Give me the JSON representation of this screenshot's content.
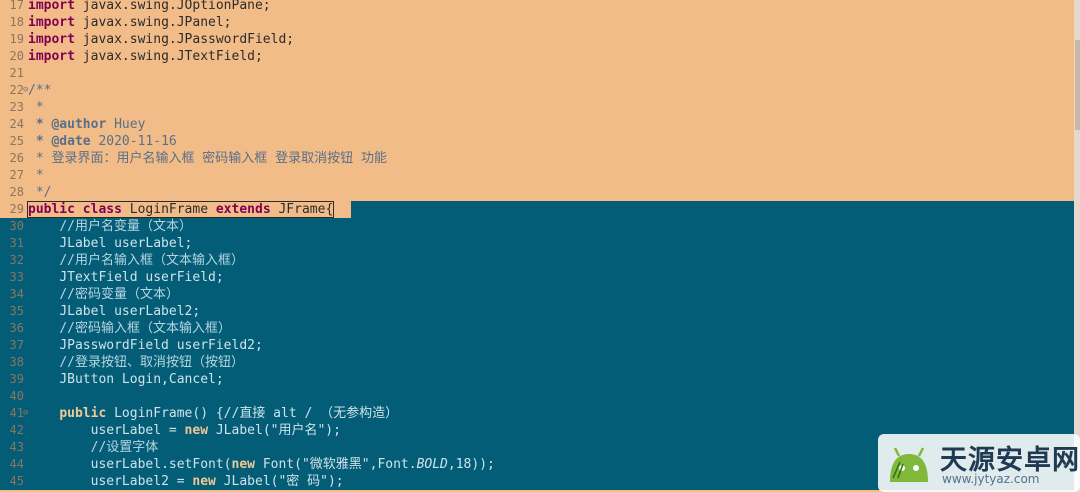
{
  "editor": {
    "lines": [
      {
        "num": "17",
        "kind": "import",
        "text": "javax.swing.JOptionPane;"
      },
      {
        "num": "18",
        "kind": "import",
        "text": "javax.swing.JPanel;"
      },
      {
        "num": "19",
        "kind": "import",
        "text": "javax.swing.JPasswordField;"
      },
      {
        "num": "20",
        "kind": "import",
        "text": "javax.swing.JTextField;"
      },
      {
        "num": "21",
        "kind": "blank",
        "text": ""
      },
      {
        "num": "22",
        "kind": "jdoc-open",
        "text": "/**"
      },
      {
        "num": "23",
        "kind": "jdoc",
        "text": " *"
      },
      {
        "num": "24",
        "kind": "jdoc-tag",
        "tag": " * @author",
        "text": " Huey"
      },
      {
        "num": "25",
        "kind": "jdoc-tag",
        "tag": " * @date",
        "text": " 2020-11-16"
      },
      {
        "num": "26",
        "kind": "jdoc",
        "text": " * 登录界面：用户名输入框 密码输入框 登录取消按钮 功能"
      },
      {
        "num": "27",
        "kind": "jdoc",
        "text": " *"
      },
      {
        "num": "28",
        "kind": "jdoc",
        "text": " */"
      },
      {
        "num": "29",
        "kind": "classdecl",
        "text": ""
      },
      {
        "num": "30",
        "kind": "comment",
        "indent": "    ",
        "text": "//用户名变量（文本）"
      },
      {
        "num": "31",
        "kind": "code",
        "indent": "    ",
        "text": "JLabel userLabel;"
      },
      {
        "num": "32",
        "kind": "comment",
        "indent": "    ",
        "text": "//用户名输入框（文本输入框）"
      },
      {
        "num": "33",
        "kind": "code",
        "indent": "    ",
        "text": "JTextField userField;"
      },
      {
        "num": "34",
        "kind": "comment",
        "indent": "    ",
        "text": "//密码变量（文本）"
      },
      {
        "num": "35",
        "kind": "code",
        "indent": "    ",
        "text": "JLabel userLabel2;"
      },
      {
        "num": "36",
        "kind": "comment",
        "indent": "    ",
        "text": "//密码输入框（文本输入框）"
      },
      {
        "num": "37",
        "kind": "code",
        "indent": "    ",
        "text": "JPasswordField userField2;"
      },
      {
        "num": "38",
        "kind": "comment",
        "indent": "    ",
        "text": "//登录按钮、取消按钮（按钮）"
      },
      {
        "num": "39",
        "kind": "code",
        "indent": "    ",
        "text": "JButton Login,Cancel;"
      },
      {
        "num": "40",
        "kind": "blank",
        "text": ""
      },
      {
        "num": "41",
        "kind": "ctor",
        "text": ""
      },
      {
        "num": "42",
        "kind": "newlabel",
        "indent": "        ",
        "pre": "userLabel = ",
        "post": " JLabel(\"用户名\");"
      },
      {
        "num": "43",
        "kind": "comment",
        "indent": "        ",
        "text": "//设置字体"
      },
      {
        "num": "44",
        "kind": "setfont",
        "text": ""
      },
      {
        "num": "45",
        "kind": "newlabel",
        "indent": "        ",
        "pre": "userLabel2 = ",
        "post": " JLabel(\"密 码\");"
      }
    ],
    "tokens": {
      "import": "import",
      "public": "public",
      "class": "class",
      "extends": "extends",
      "new": "new",
      "class_name": " LoginFrame ",
      "super_name": " JFrame{",
      "ctor_rest": " LoginFrame() {//直接 alt / （无参构造）",
      "setfont_pre": "userLabel.setFont(",
      "setfont_mid": " Font(\"微软雅黑\",Font.",
      "setfont_bold": "BOLD",
      "setfont_end": ",18));"
    }
  },
  "watermark": {
    "title": "天源安卓网",
    "url": "www.jytyaz.com"
  },
  "colors": {
    "background": "#f2bc89",
    "selection": "#035d77",
    "keyword": "#7f0055"
  }
}
